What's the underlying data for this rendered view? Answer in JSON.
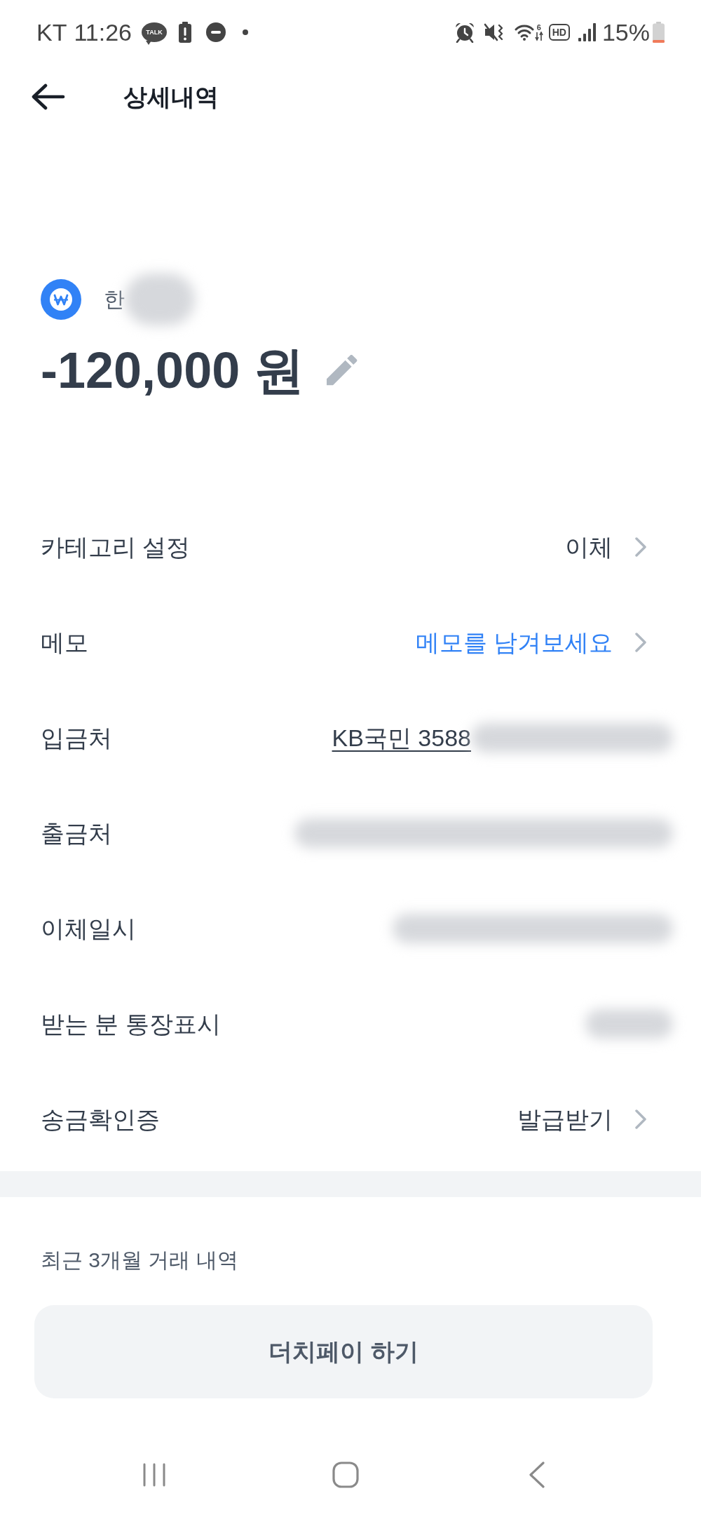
{
  "status_bar": {
    "carrier": "KT",
    "time": "11:26",
    "notification_badge": "TALK",
    "wifi_label": "6",
    "hd_label": "HD",
    "battery": "15%"
  },
  "header": {
    "title": "상세내역"
  },
  "summary": {
    "name": "한",
    "name_blurred": true,
    "amount": "-120,000 원"
  },
  "rows": [
    {
      "label": "카테고리 설정",
      "kind": "link",
      "value": "이체"
    },
    {
      "label": "메모",
      "kind": "prompt",
      "value": "메모를 남겨보세요"
    },
    {
      "label": "입금처",
      "kind": "account",
      "value": "KB국민 3588"
    },
    {
      "label": "출금처",
      "kind": "redacted"
    },
    {
      "label": "이체일시",
      "kind": "redacted"
    },
    {
      "label": "받는 분 통장표시",
      "kind": "redacted"
    },
    {
      "label": "송금확인증",
      "kind": "link",
      "value": "발급받기"
    }
  ],
  "recent": {
    "title": "최근 3개월 거래 내역"
  },
  "action_button": {
    "label": "더치페이 하기"
  }
}
